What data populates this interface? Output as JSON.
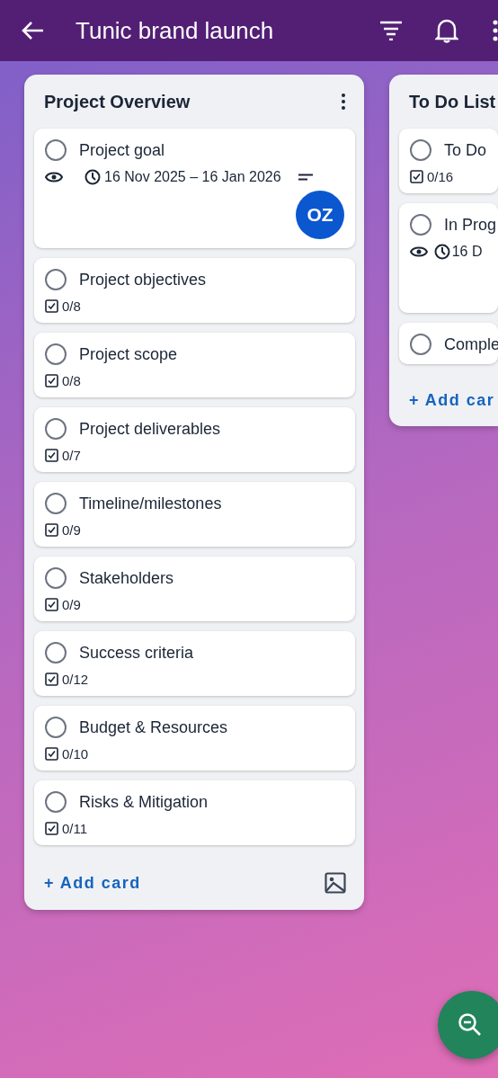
{
  "header": {
    "title": "Tunic brand launch"
  },
  "lists": [
    {
      "title": "Project Overview",
      "add_label": "+ Add card",
      "cards": [
        {
          "kind": "detail",
          "title": "Project goal",
          "completed": false,
          "dates": "16 Nov 2025 – 16 Jan 2026",
          "avatar": "OZ"
        },
        {
          "kind": "checklist",
          "title": "Project objectives",
          "completed": false,
          "count": "0/8"
        },
        {
          "kind": "checklist",
          "title": "Project scope",
          "completed": false,
          "count": "0/8"
        },
        {
          "kind": "checklist",
          "title": "Project deliverables",
          "completed": false,
          "count": "0/7"
        },
        {
          "kind": "checklist",
          "title": "Timeline/milestones",
          "completed": false,
          "count": "0/9"
        },
        {
          "kind": "checklist",
          "title": "Stakeholders",
          "completed": false,
          "count": "0/9"
        },
        {
          "kind": "checklist",
          "title": "Success criteria",
          "completed": false,
          "count": "0/12"
        },
        {
          "kind": "checklist",
          "title": "Budget & Resources",
          "completed": false,
          "count": "0/10"
        },
        {
          "kind": "checklist",
          "title": "Risks & Mitigation",
          "completed": false,
          "count": "0/11"
        }
      ]
    },
    {
      "title": "To Do List",
      "add_label": "+ Add car",
      "cards": [
        {
          "kind": "checklist",
          "title": "To Do",
          "completed": false,
          "count": "0/16"
        },
        {
          "kind": "detail",
          "title": "In Prog",
          "completed": false,
          "dates": "16 D"
        },
        {
          "kind": "plain",
          "title": "Comple",
          "completed": false
        }
      ]
    }
  ]
}
